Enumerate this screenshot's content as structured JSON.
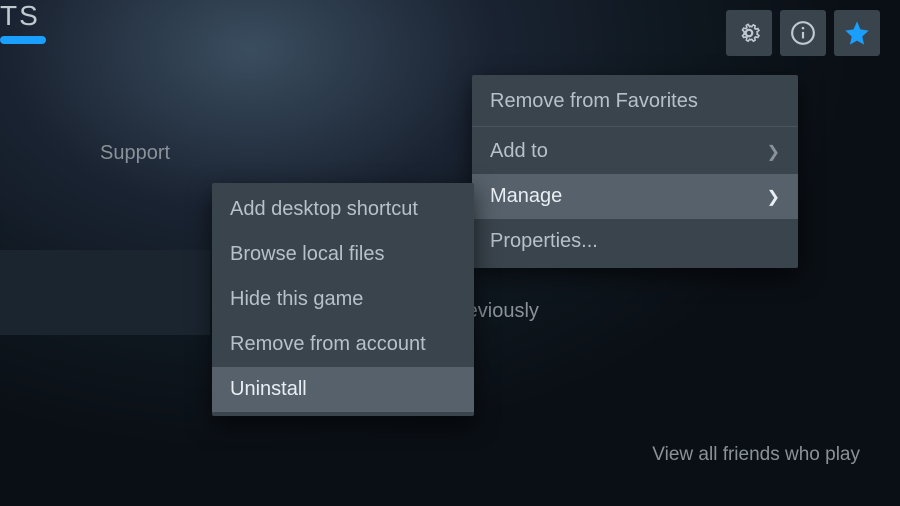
{
  "title_fragment": "TS",
  "tabs": {
    "support": "Support"
  },
  "body": {
    "previously_fragment": "reviously",
    "friends_link": "View all friends who play"
  },
  "icons": {
    "gear": "gear",
    "info": "info",
    "star": "star"
  },
  "primary_menu": {
    "items": [
      {
        "label": "Remove from Favorites",
        "submenu": false,
        "hovered": false
      },
      {
        "label": "Add to",
        "submenu": true,
        "hovered": false
      },
      {
        "label": "Manage",
        "submenu": true,
        "hovered": true
      },
      {
        "label": "Properties...",
        "submenu": false,
        "hovered": false
      }
    ]
  },
  "secondary_menu": {
    "items": [
      {
        "label": "Add desktop shortcut",
        "hovered": false
      },
      {
        "label": "Browse local files",
        "hovered": false
      },
      {
        "label": "Hide this game",
        "hovered": false
      },
      {
        "label": "Remove from account",
        "hovered": false
      },
      {
        "label": "Uninstall",
        "hovered": true
      }
    ]
  },
  "colors": {
    "accent_blue": "#1a9fff",
    "menu_bg": "#3a444d",
    "hover_bg": "#56616b"
  }
}
